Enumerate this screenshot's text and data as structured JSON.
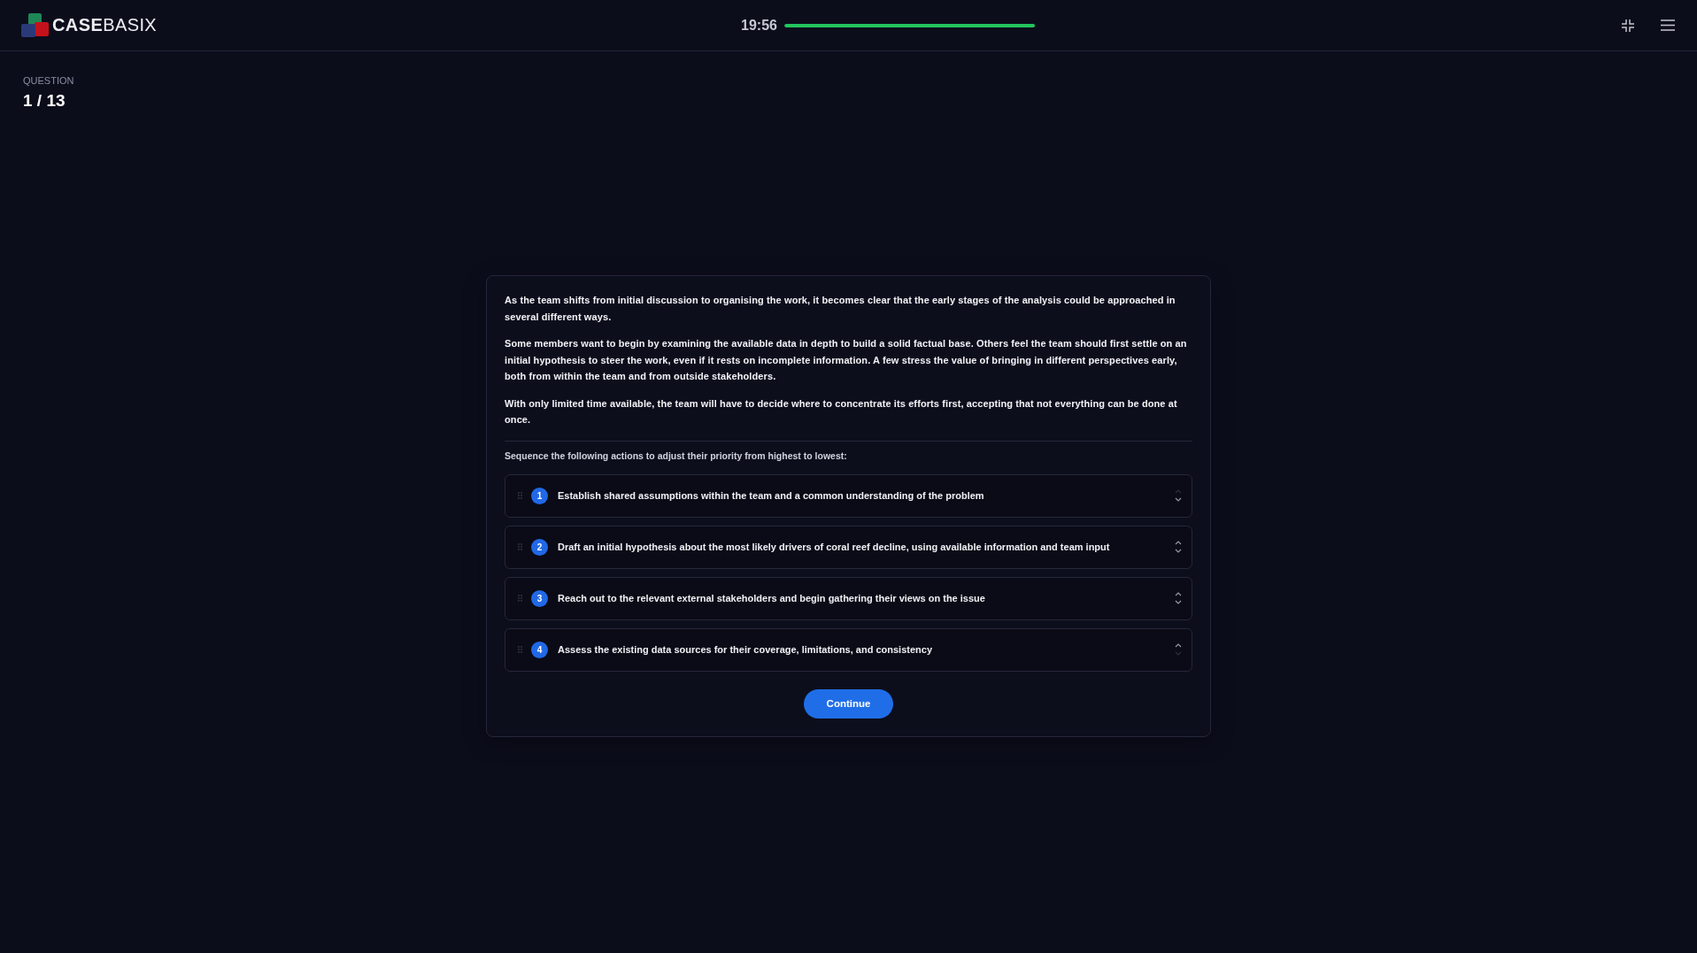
{
  "header": {
    "logo": "**CASE**BASIX",
    "timer": {
      "time": "19:56",
      "level": 0.997
    }
  },
  "question": {
    "label": "QUESTION",
    "counter": "1 / 13"
  },
  "card": {
    "paragraphs": [
      "As the team shifts from initial discussion to organising the work, it becomes clear that the early stages of the analysis could be approached in several different ways.",
      "Some members want to begin by examining the available data in depth to build a solid factual base. Others feel the team should first settle on an initial hypothesis to steer the work, even if it rests on incomplete information. A few stress the value of bringing in different perspectives early, both from within the team and from outside stakeholders.",
      "With only limited time available, the team will have to decide where to concentrate its efforts first, accepting that not everything can be done at once."
    ],
    "prompt": "Sequence the following actions to adjust their priority from highest to lowest:",
    "items": [
      {
        "number": "1",
        "text": "Establish shared assumptions within the team and a common understanding of the problem",
        "up_disabled": true,
        "down_disabled": false
      },
      {
        "number": "2",
        "text": "Draft an initial hypothesis about the most likely drivers of coral reef decline, using available information and team input",
        "up_disabled": false,
        "down_disabled": false
      },
      {
        "number": "3",
        "text": "Reach out to the relevant external stakeholders and begin gathering their views on the issue",
        "up_disabled": false,
        "down_disabled": false
      },
      {
        "number": "4",
        "text": "Assess the existing data sources for their coverage, limitations, and consistency",
        "up_disabled": false,
        "down_disabled": true
      }
    ],
    "button": "Continue"
  }
}
